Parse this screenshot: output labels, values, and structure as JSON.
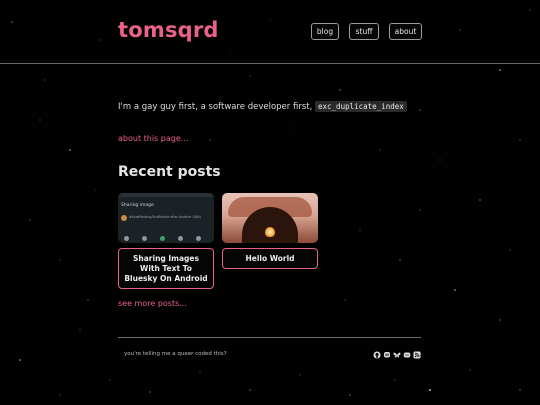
{
  "site": {
    "logo": "tomsqrd",
    "nav": [
      {
        "label": "blog"
      },
      {
        "label": "stuff"
      },
      {
        "label": "about"
      }
    ]
  },
  "intro": {
    "text": "I'm a gay guy first, a software developer first,",
    "code": "exc_duplicate_index"
  },
  "about_link": "about this page...",
  "recent_posts": {
    "heading": "Recent posts",
    "posts": [
      {
        "title": "Sharing Images With Text To Bluesky On Android",
        "thumb_header": "Sharing image",
        "thumb_text": "#blueRanking/SnoRankle after Another (Still)"
      },
      {
        "title": "Hello World"
      }
    ]
  },
  "more_link": "see more posts...",
  "footer": {
    "text": "you're telling me a queer coded this?",
    "social_icons": [
      "github-icon",
      "mastodon-icon",
      "bluesky-icon",
      "discord-icon",
      "rss-icon"
    ]
  },
  "colors": {
    "accent": "#e8628a",
    "background": "#010101",
    "text": "#dedede"
  }
}
